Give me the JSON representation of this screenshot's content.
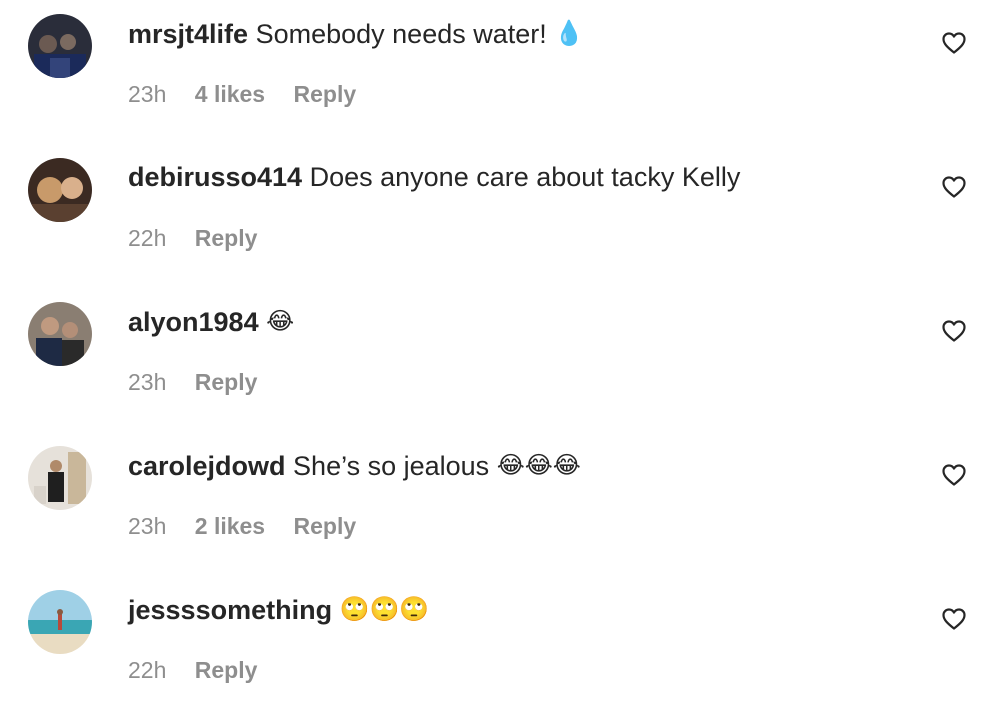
{
  "comments": [
    {
      "username": "mrsjt4life",
      "text": "Somebody needs water!",
      "emoji": "💧",
      "time": "23h",
      "likes": "4 likes",
      "reply": "Reply",
      "heart_icon": "heart-outline-icon"
    },
    {
      "username": "debirusso414",
      "text": "Does anyone care about tacky Kelly",
      "emoji": "",
      "time": "22h",
      "likes": "",
      "reply": "Reply",
      "heart_icon": "heart-outline-icon"
    },
    {
      "username": "alyon1984",
      "text": "",
      "emoji": "😂",
      "time": "23h",
      "likes": "",
      "reply": "Reply",
      "heart_icon": "heart-outline-icon"
    },
    {
      "username": "carolejdowd",
      "text": "She’s so jealous",
      "emoji": "😂😂😂",
      "time": "23h",
      "likes": "2 likes",
      "reply": "Reply",
      "heart_icon": "heart-outline-icon"
    },
    {
      "username": "jessssomething",
      "text": "",
      "emoji": "🙄🙄🙄",
      "time": "22h",
      "likes": "",
      "reply": "Reply",
      "heart_icon": "heart-outline-icon"
    }
  ],
  "colors": {
    "text": "#262626",
    "secondary": "#8e8e8e",
    "background": "#ffffff"
  }
}
